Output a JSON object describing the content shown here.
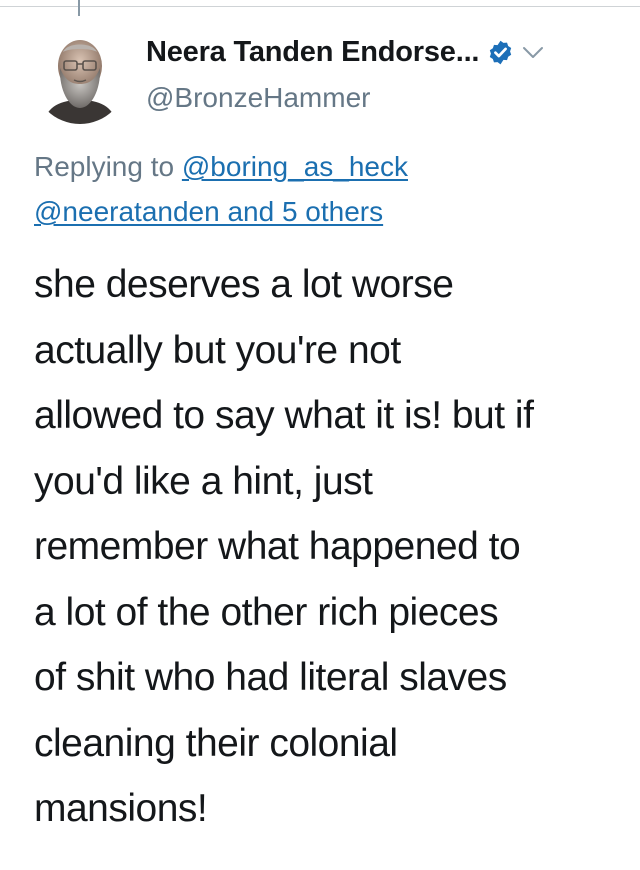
{
  "tweet": {
    "author": {
      "display_name": "Neera Tanden Endorse...",
      "handle": "@BronzeHammer",
      "verified": true,
      "avatar": "elderly-man-with-glasses-and-beard-photo"
    },
    "icons": {
      "verified": "verified-badge-icon",
      "menu": "chevron-down-icon"
    },
    "reply_context": {
      "prefix": "Replying to",
      "mention_1": "@boring_as_heck",
      "mention_2": "@neeratanden and 5 others"
    },
    "text_lines": [
      "she deserves a lot worse",
      "actually but you're not",
      "allowed to say what it is! but if",
      "you'd like a hint, just",
      "remember what happened to",
      "a lot of the other rich pieces",
      "of shit who had literal slaves",
      "cleaning their colonial",
      "mansions!"
    ]
  },
  "colors": {
    "text": "#14171a",
    "secondary": "#657786",
    "link": "#1b6fb0",
    "verified": "#1d6fb8",
    "background": "#ffffff"
  }
}
